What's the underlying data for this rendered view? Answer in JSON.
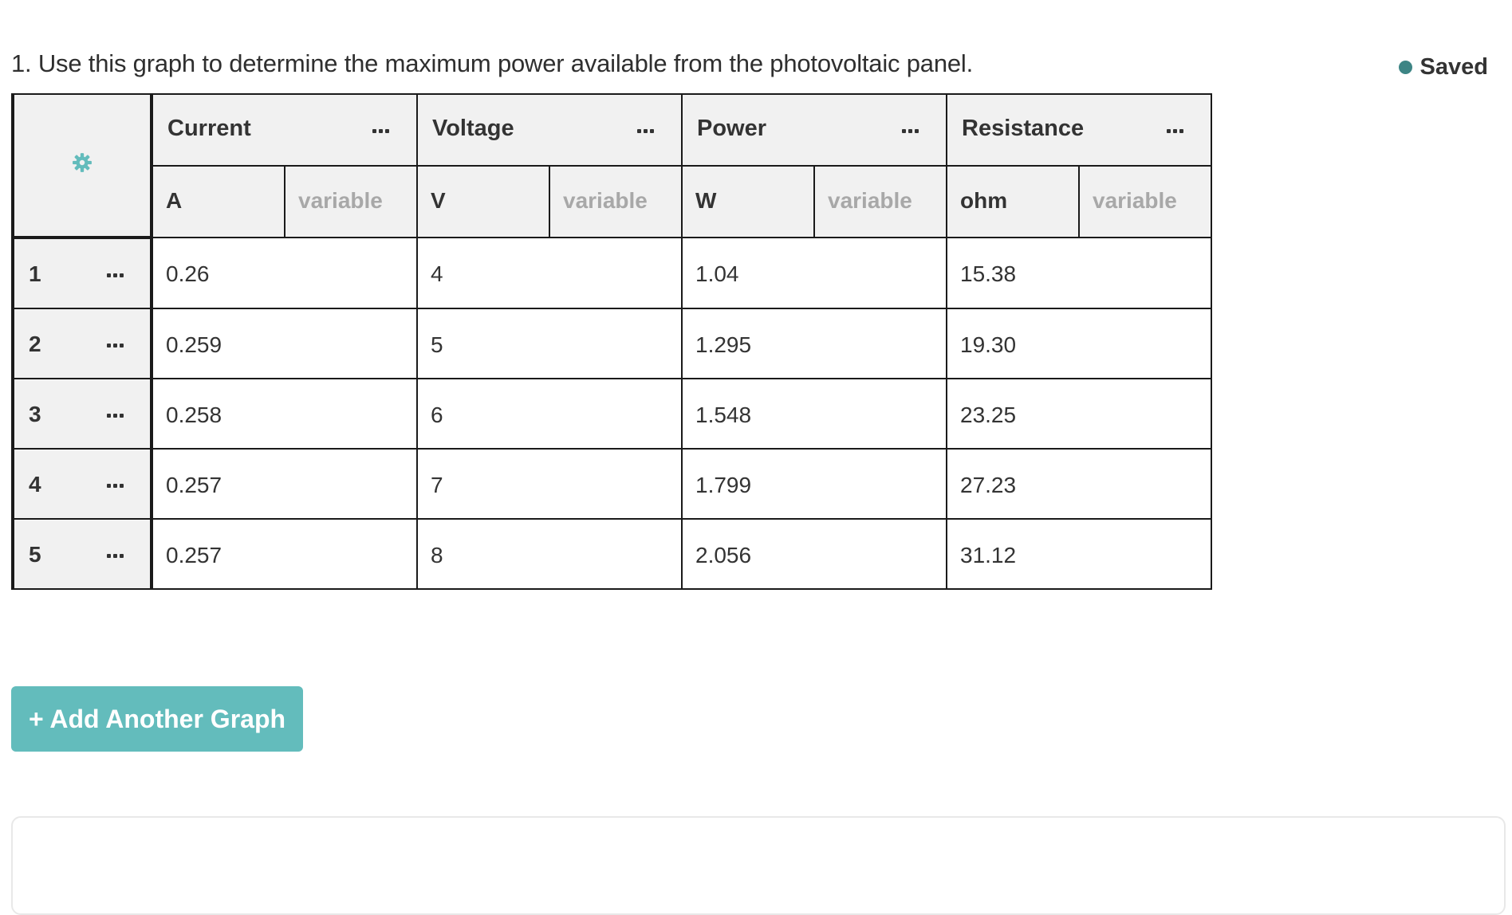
{
  "question": {
    "text": "1.  Use this graph to determine the maximum power available from the photovoltaic panel."
  },
  "status": {
    "label": "Saved",
    "dot_color": "#3d8585"
  },
  "table": {
    "settings_icon": "gear-icon",
    "columns": [
      {
        "name": "Current",
        "unit": "A",
        "unit_placeholder": "variable"
      },
      {
        "name": "Voltage",
        "unit": "V",
        "unit_placeholder": "variable"
      },
      {
        "name": "Power",
        "unit": "W",
        "unit_placeholder": "variable"
      },
      {
        "name": "Resistance",
        "unit": "ohm",
        "unit_placeholder": "variable"
      }
    ],
    "rows": [
      {
        "num": "1",
        "values": [
          "0.26",
          "4",
          "1.04",
          "15.38"
        ]
      },
      {
        "num": "2",
        "values": [
          "0.259",
          "5",
          "1.295",
          "19.30"
        ]
      },
      {
        "num": "3",
        "values": [
          "0.258",
          "6",
          "1.548",
          "23.25"
        ]
      },
      {
        "num": "4",
        "values": [
          "0.257",
          "7",
          "1.799",
          "27.23"
        ]
      },
      {
        "num": "5",
        "values": [
          "0.257",
          "8",
          "2.056",
          "31.12"
        ]
      }
    ]
  },
  "actions": {
    "add_graph_label": "+ Add Another Graph",
    "accent": "#63bcbc"
  }
}
